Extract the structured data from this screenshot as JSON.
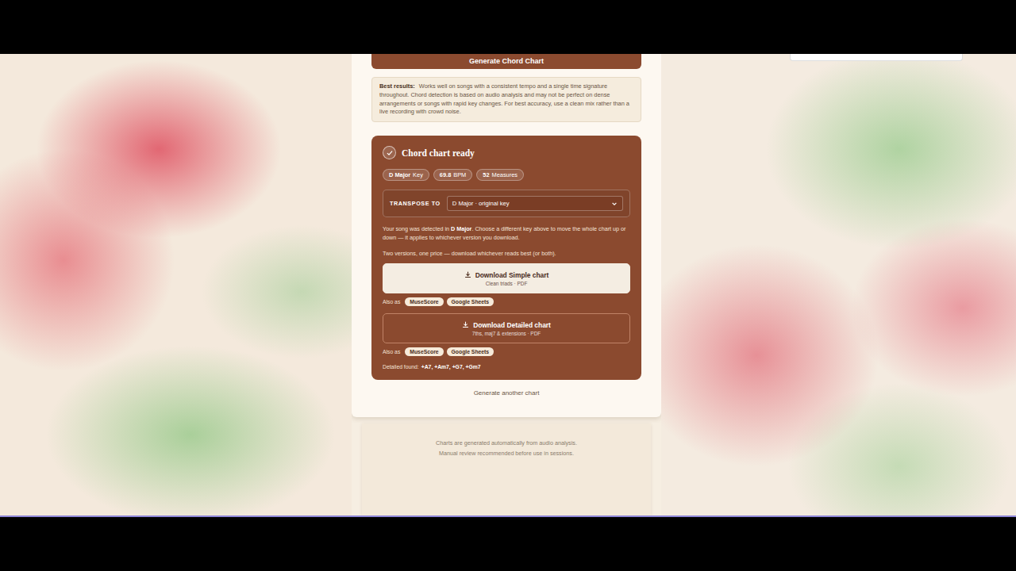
{
  "generate_button": {
    "label": "Generate Chord Chart"
  },
  "note": {
    "label": "Best results:",
    "text": "Works well on songs with a consistent tempo and a single time signature throughout. Chord detection is based on audio analysis and may not be perfect on dense arrangements or songs with rapid key changes. For best accuracy, use a clean mix rather than a live recording with crowd noise."
  },
  "result": {
    "title": "Chord chart ready",
    "badges": [
      {
        "value": "D Major",
        "unit": "Key"
      },
      {
        "value": "69.8",
        "unit": "BPM"
      },
      {
        "value": "52",
        "unit": "Measures"
      }
    ],
    "transpose": {
      "label": "TRANSPOSE TO",
      "value": "D Major · original key"
    },
    "detected": {
      "before": "Your song was detected in",
      "key": "D Major",
      "after": ". Choose a different key above to move the whole chart up or down — it applies to whichever version you download."
    },
    "versions_note": "Two versions, one price — download whichever reads best (or both).",
    "downloads": [
      {
        "label": "Download Simple chart",
        "sub": "Clean triads · PDF",
        "kind": "primary",
        "also_label": "Also as",
        "formats": [
          "MuseScore",
          "Google Sheets"
        ]
      },
      {
        "label": "Download Detailed chart",
        "sub": "7ths, maj7 & extensions · PDF",
        "kind": "outline",
        "also_label": "Also as",
        "formats": [
          "MuseScore",
          "Google Sheets"
        ]
      }
    ],
    "detailed_found": {
      "label": "Detailed found:",
      "chords": "+A7, +Am7, +G7, +Gm7"
    }
  },
  "another_link": "Generate another chart",
  "footer": [
    "Charts are generated automatically from audio analysis.",
    "Manual review recommended before use in sessions."
  ]
}
